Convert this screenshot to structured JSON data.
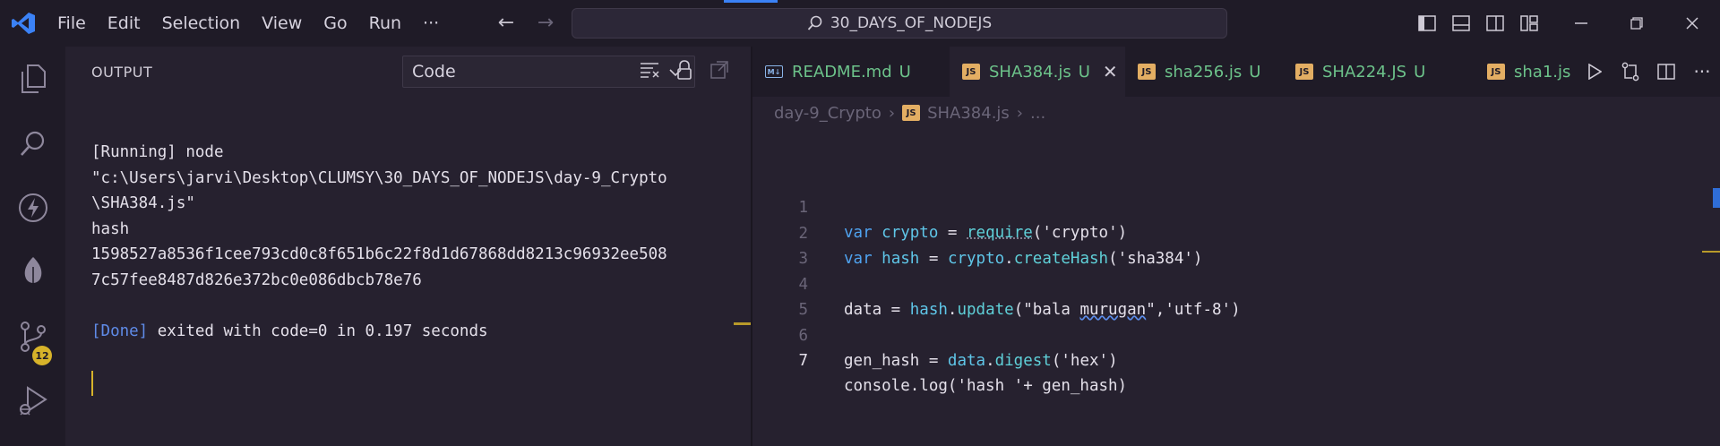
{
  "titlebar": {
    "menu": [
      "File",
      "Edit",
      "Selection",
      "View",
      "Go",
      "Run",
      "···"
    ],
    "search_text": "30_DAYS_OF_NODEJS",
    "accent": "#3b82f6"
  },
  "activity_bar": {
    "items": [
      "explorer-icon",
      "search-icon",
      "lightning-icon",
      "leaf-icon",
      "source-control-icon",
      "run-debug-icon"
    ],
    "source_control_badge": "12"
  },
  "output_panel": {
    "title": "OUTPUT",
    "channel": "Code",
    "lines": [
      "[Running] node",
      "\"c:\\Users\\jarvi\\Desktop\\CLUMSY\\30_DAYS_OF_NODEJS\\day-9_Crypto",
      "\\SHA384.js\"",
      "hash",
      "1598527a8536f1cee793cd0c8f651b6c22f8d1d67868dd8213c96932ee508",
      "7c57fee8487d826e372bc0e086dbcb78e76",
      ""
    ],
    "done_tag": "[Done]",
    "done_text": " exited with code=0 in 0.197 seconds"
  },
  "editor": {
    "tabs": [
      {
        "icon": "md",
        "name": "README.md",
        "status": "U",
        "active": false
      },
      {
        "icon": "js",
        "name": "SHA384.js",
        "status": "U",
        "active": true
      },
      {
        "icon": "js",
        "name": "sha256.js",
        "status": "U",
        "active": false
      },
      {
        "icon": "js",
        "name": "SHA224.JS",
        "status": "U",
        "active": false
      },
      {
        "icon": "js",
        "name": "sha1.js",
        "status": "",
        "active": false
      }
    ],
    "breadcrumb": {
      "folder": "day-9_Crypto",
      "file": "SHA384.js",
      "more": "..."
    },
    "current_line": 7,
    "code_lines": [
      "1",
      "2",
      "3",
      "4",
      "5",
      "6",
      "7"
    ]
  },
  "colors": {
    "titlebar_bg": "#1f1b27",
    "editor_bg": "#26212f",
    "git_untracked": "#6cc28a",
    "badge": "#d7b32a"
  }
}
